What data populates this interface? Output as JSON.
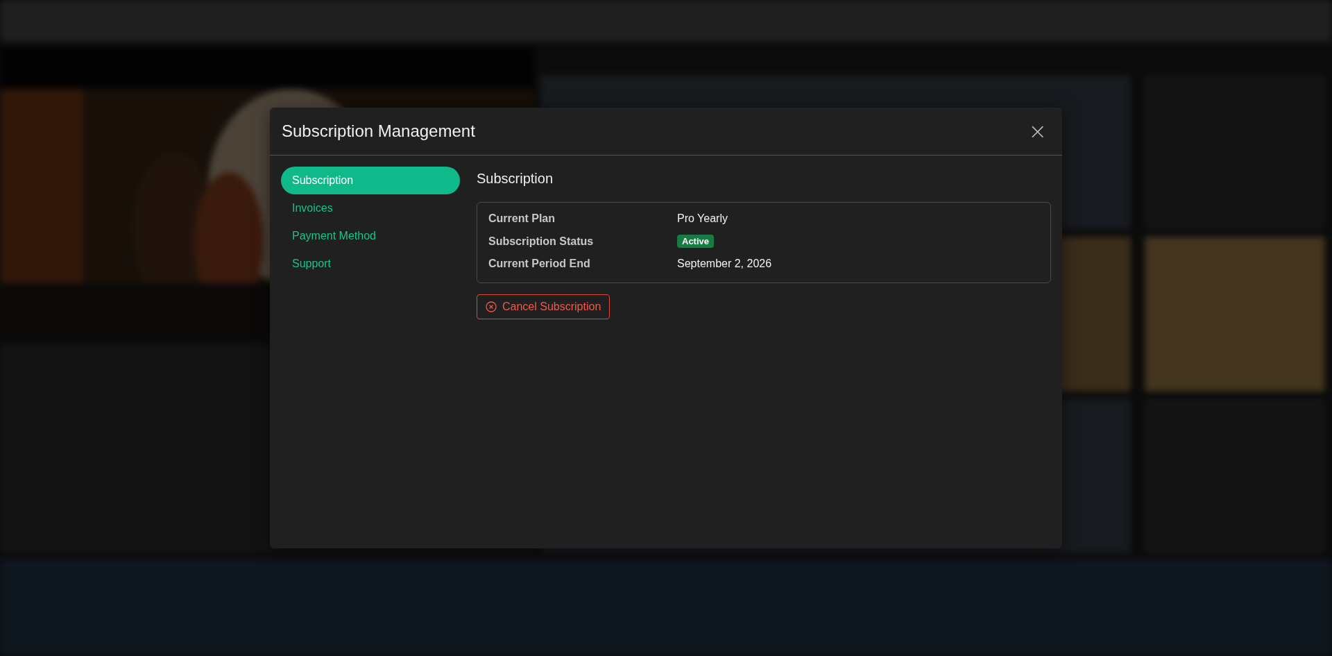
{
  "dialog": {
    "title": "Subscription Management",
    "close": "×"
  },
  "nav": [
    {
      "label": "Subscription",
      "selected": true
    },
    {
      "label": "Invoices",
      "selected": false
    },
    {
      "label": "Payment Method",
      "selected": false
    },
    {
      "label": "Support",
      "selected": false
    }
  ],
  "section_title": "Subscription",
  "details": [
    {
      "label": "Current Plan",
      "value": "Pro Yearly",
      "kind": "text"
    },
    {
      "label": "Subscription Status",
      "value": "Active",
      "kind": "badge"
    },
    {
      "label": "Current Period End",
      "value": "September 2, 2026",
      "kind": "text"
    }
  ],
  "cancel_button": "Cancel Subscription"
}
